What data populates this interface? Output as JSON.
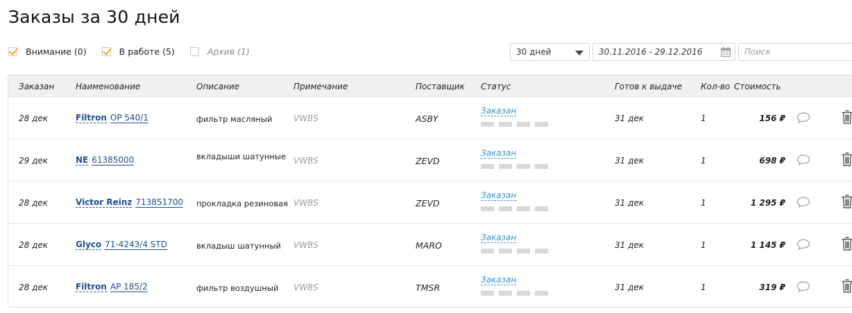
{
  "page": {
    "title": "Заказы за 30 дней"
  },
  "filters": [
    {
      "label": "Внимание (0)",
      "checked": true
    },
    {
      "label": "В работе (5)",
      "checked": true
    },
    {
      "label": "Архив (1)",
      "checked": false
    }
  ],
  "controls": {
    "period": "30 дней",
    "date_range": "30.11.2016 - 29.12.2016",
    "search_placeholder": "Поиск"
  },
  "table": {
    "headers": {
      "ordered": "Заказан",
      "name": "Наименование",
      "description": "Описание",
      "note": "Примечание",
      "supplier": "Поставщик",
      "status": "Статус",
      "ready": "Готов к выдаче",
      "qty": "Кол-во",
      "price": "Стоимость"
    },
    "rows": [
      {
        "date": "28 дек",
        "brand": "Filtron",
        "part": "OP 540/1",
        "description": "фильтр масляный",
        "note": "VWBS",
        "supplier": "ASBY",
        "status": "Заказан",
        "ready": "31 дек",
        "qty": "1",
        "price": "156 ₽"
      },
      {
        "date": "29 дек",
        "brand": "NE",
        "part": "61385000",
        "description": "вкладыши шатунные",
        "note": "VWBS",
        "supplier": "ZEVD",
        "status": "Заказан",
        "ready": "31 дек",
        "qty": "1",
        "price": "698 ₽"
      },
      {
        "date": "28 дек",
        "brand": "Victor Reinz",
        "part": "713851700",
        "description": "прокладка резиновая",
        "note": "VWBS",
        "supplier": "ZEVD",
        "status": "Заказан",
        "ready": "31 дек",
        "qty": "1",
        "price": "1 295 ₽"
      },
      {
        "date": "28 дек",
        "brand": "Glyco",
        "part": "71-4243/4 STD",
        "description": "вкладыш шатунный",
        "note": "VWBS",
        "supplier": "MARO",
        "status": "Заказан",
        "ready": "31 дек",
        "qty": "1",
        "price": "1 145 ₽"
      },
      {
        "date": "28 дек",
        "brand": "Filtron",
        "part": "AP 185/2",
        "description": "фильтр воздушный",
        "note": "VWBS",
        "supplier": "TMSR",
        "status": "Заказан",
        "ready": "31 дек",
        "qty": "1",
        "price": "319 ₽"
      }
    ]
  },
  "colors": {
    "accent_check": "#f0a81a",
    "link": "#1a4d8c",
    "status": "#3a93c9",
    "header_bg": "#f0f0f0"
  }
}
